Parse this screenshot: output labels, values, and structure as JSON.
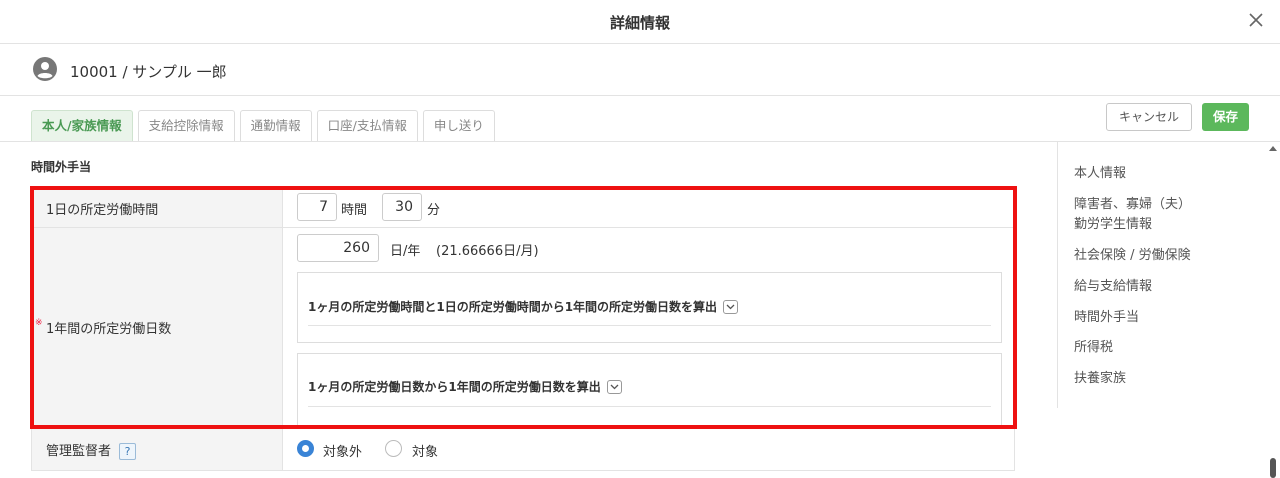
{
  "dialog": {
    "title": "詳細情報"
  },
  "user": {
    "name": "10001 / サンプル 一郎"
  },
  "tabs": [
    {
      "label": "本人/家族情報",
      "active": true
    },
    {
      "label": "支給控除情報",
      "active": false
    },
    {
      "label": "通勤情報",
      "active": false
    },
    {
      "label": "口座/支払情報",
      "active": false
    },
    {
      "label": "申し送り",
      "active": false
    }
  ],
  "actions": {
    "cancel": "キャンセル",
    "save": "保存"
  },
  "section": {
    "title": "時間外手当"
  },
  "fields": {
    "daily_hours": {
      "label": "1日の所定労働時間",
      "hours": "7",
      "hours_unit": "時間",
      "minutes": "30",
      "minutes_unit": "分"
    },
    "annual_days": {
      "label": "1年間の所定労働日数",
      "required_mark": "※",
      "value": "260",
      "unit": "日/年",
      "note": "(21.66666日/月)",
      "calc_options": [
        {
          "title": "1ヶ月の所定労働時間と1日の所定労働時間から1年間の所定労働日数を算出"
        },
        {
          "title": "1ヶ月の所定労働日数から1年間の所定労働日数を算出"
        }
      ]
    },
    "manager": {
      "label": "管理監督者",
      "help": "?",
      "options": [
        {
          "label": "対象外",
          "selected": true
        },
        {
          "label": "対象",
          "selected": false
        }
      ]
    }
  },
  "sidenav": {
    "items": [
      "本人情報",
      "障害者、寡婦（夫）",
      "勤労学生情報",
      "社会保険 / 労働保険",
      "給与支給情報",
      "時間外手当",
      "所得税",
      "扶養家族"
    ]
  },
  "colors": {
    "accent": "#5cb85c",
    "highlight": "#ee1111",
    "radio": "#3a84d6"
  }
}
